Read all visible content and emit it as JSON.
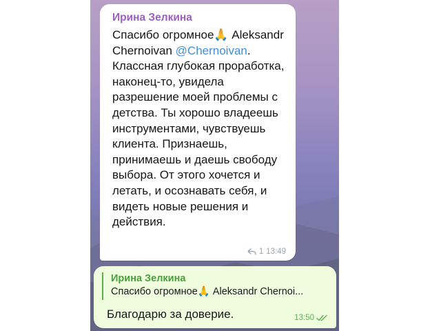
{
  "incoming_message": {
    "sender": "Ирина Зелкина",
    "text_before_mention": "Спасибо огромное🙏 Aleksandr Chernoivan ",
    "mention": "@Chernoivan",
    "text_after_mention": ". Классная глубокая проработка, наконец-то, увидела разрешение моей проблемы с детства. Ты хорошо владеешь инструментами, чувствуешь клиента. Признаешь, принимаешь и даешь свободу выбора. От этого хочется и летать, и осознавать себя, и видеть новые решения и действия.",
    "reply_count": "1",
    "time": "13:49",
    "reply_icon": "reply-arrow-icon"
  },
  "outgoing_message": {
    "quote_sender": "Ирина Зелкина",
    "quote_text": "Спасибо огромное🙏 Aleksandr Chernoi...",
    "text": "Благодарю за доверие.",
    "time": "13:50",
    "status_icon": "double-check-icon"
  },
  "colors": {
    "sender_name": "#9b5fc0",
    "mention": "#3f8ed6",
    "quote_accent": "#4aa03c",
    "outgoing_bubble": "#effdde",
    "incoming_bubble": "#ffffff"
  }
}
